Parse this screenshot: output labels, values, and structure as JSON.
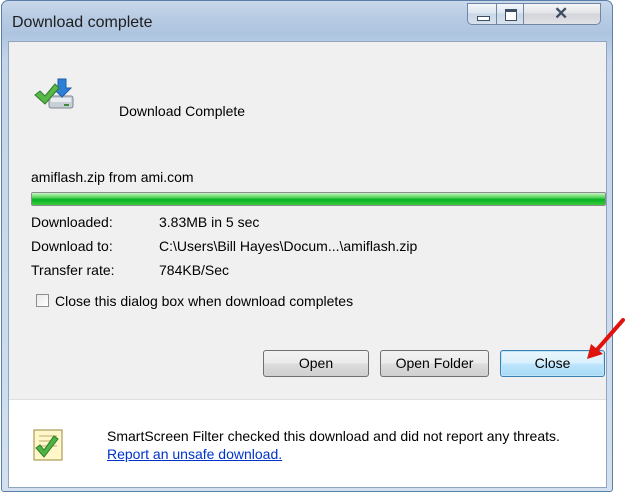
{
  "window": {
    "title": "Download complete"
  },
  "header": {
    "status": "Download Complete"
  },
  "download": {
    "filename": "amiflash.zip from ami.com",
    "progress_percent": 100,
    "details": [
      {
        "label": "Downloaded:",
        "value": "3.83MB in 5 sec"
      },
      {
        "label": "Download to:",
        "value": "C:\\Users\\Bill Hayes\\Docum...\\amiflash.zip"
      },
      {
        "label": "Transfer rate:",
        "value": "784KB/Sec"
      }
    ],
    "close_when_done": {
      "label": "Close this dialog box when download completes",
      "checked": false
    }
  },
  "buttons": {
    "open": "Open",
    "open_folder": "Open Folder",
    "close": "Close"
  },
  "smartscreen": {
    "text": "SmartScreen Filter checked this download and did not report any threats.",
    "link": "Report an unsafe download."
  },
  "colors": {
    "progress_green": "#06b025",
    "link_blue": "#0033cc",
    "annotation_arrow": "#e0140f",
    "default_button_border": "#3c7fb1"
  },
  "icons": [
    "download-complete-icon",
    "smartscreen-icon",
    "minimize-icon",
    "maximize-icon",
    "close-icon",
    "annotation-arrow-icon"
  ]
}
